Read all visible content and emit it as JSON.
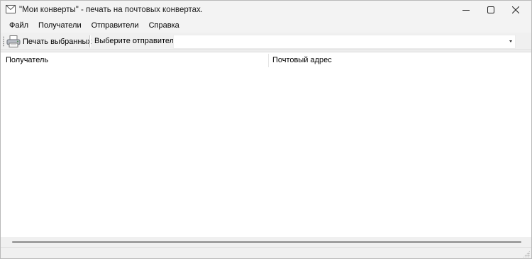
{
  "window": {
    "title": "\"Мои конверты\" - печать на почтовых конвертах."
  },
  "menu": {
    "items": [
      "Файл",
      "Получатели",
      "Отправители",
      "Справка"
    ]
  },
  "toolbar": {
    "print_label": "Печать выбранных",
    "sender_label": "Выберите отправителя:",
    "sender_value": ""
  },
  "list": {
    "columns": [
      "Получатель",
      "Почтовый адрес"
    ],
    "rows": []
  },
  "icons": {
    "app": "envelope-icon",
    "print": "printer-icon",
    "minimize": "minimize-icon",
    "maximize": "maximize-icon",
    "close": "close-icon",
    "dropdown": "chevron-down-icon"
  }
}
